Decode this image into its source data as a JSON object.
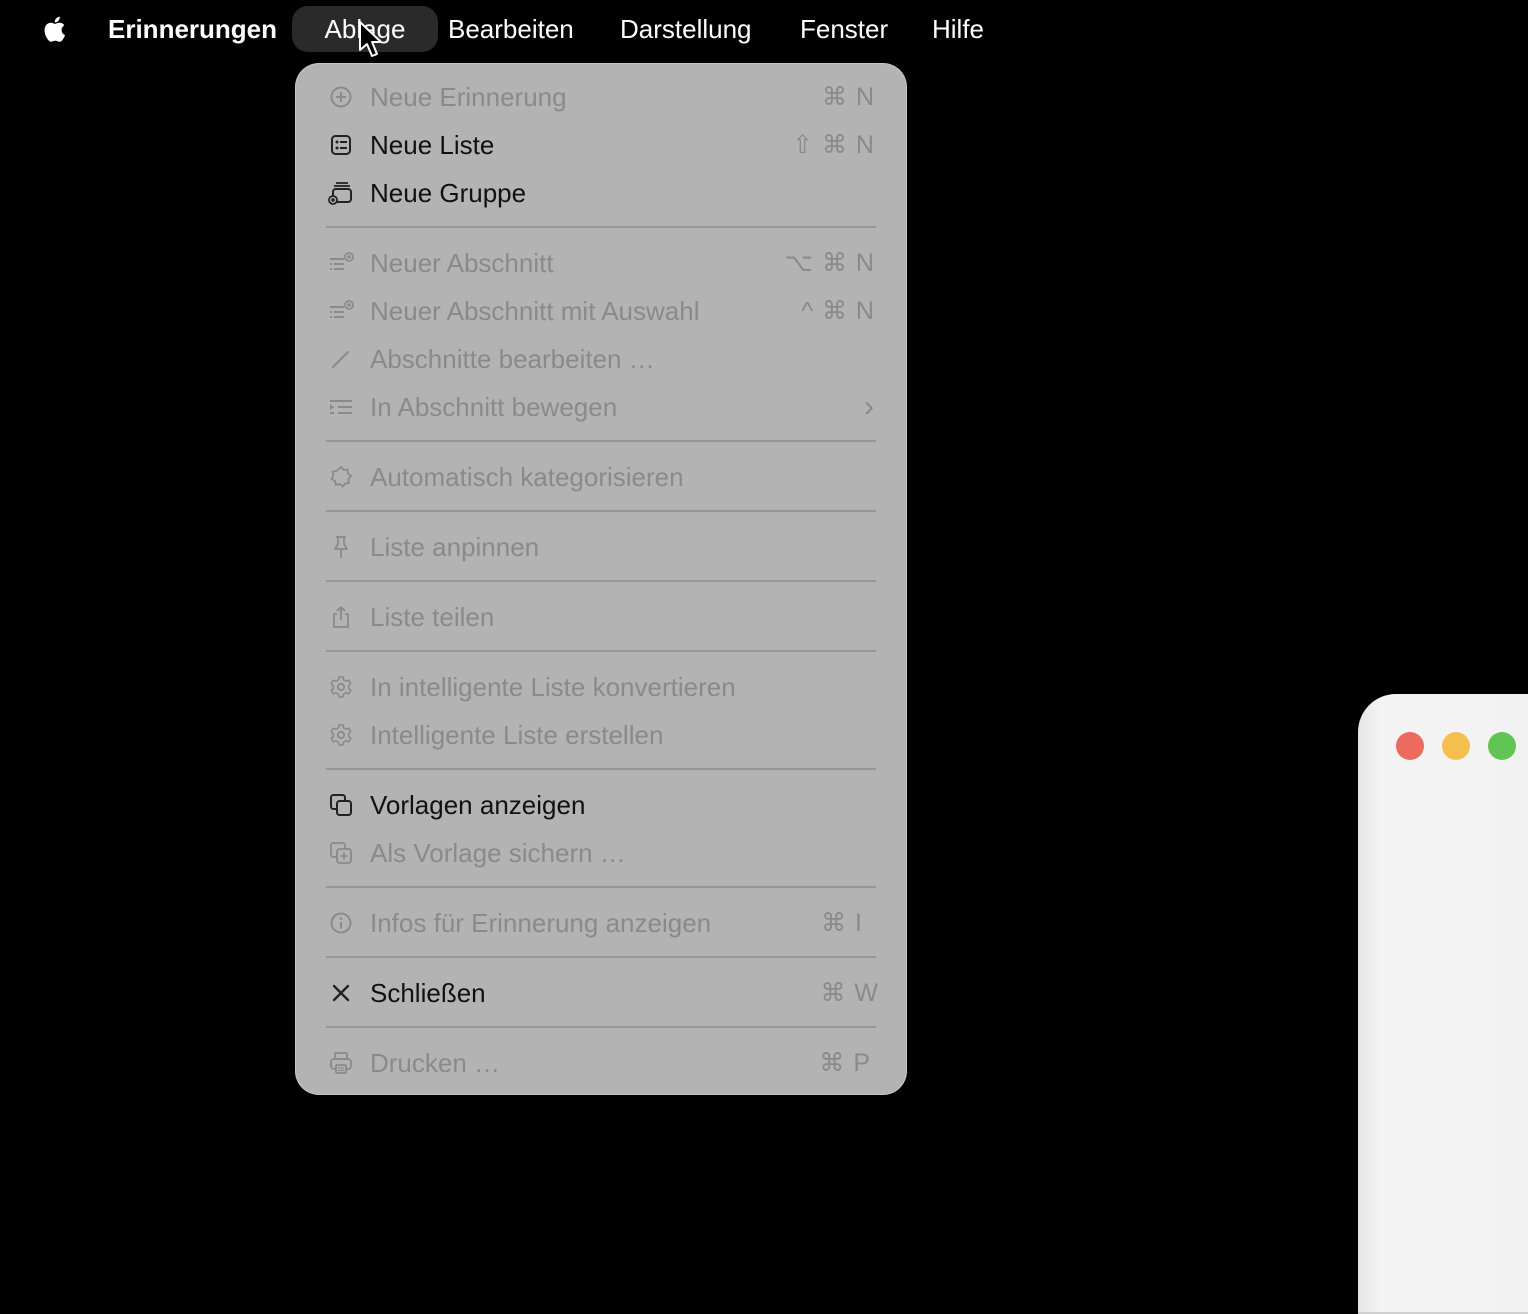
{
  "menubar": {
    "app_name": "Erinnerungen",
    "items": [
      "Ablage",
      "Bearbeiten",
      "Darstellung",
      "Fenster",
      "Hilfe"
    ]
  },
  "menu": {
    "items": [
      {
        "label": "Neue Erinnerung",
        "shortcut": "⌘ N",
        "icon": "plus-circle-icon",
        "enabled": false
      },
      {
        "label": "Neue Liste",
        "shortcut": "⇧ ⌘ N",
        "icon": "list-icon",
        "enabled": true
      },
      {
        "label": "Neue Gruppe",
        "shortcut": "",
        "icon": "group-stack-icon",
        "enabled": true
      },
      {
        "label": "Neuer Abschnitt",
        "shortcut": "⌥ ⌘ N",
        "icon": "section-add-icon",
        "enabled": false
      },
      {
        "label": "Neuer Abschnitt mit Auswahl",
        "shortcut": "^ ⌘ N",
        "icon": "section-add-icon",
        "enabled": false
      },
      {
        "label": "Abschnitte bearbeiten …",
        "shortcut": "",
        "icon": "pencil-icon",
        "enabled": false
      },
      {
        "label": "In Abschnitt bewegen",
        "shortcut": "›",
        "icon": "move-to-section-icon",
        "enabled": false
      },
      {
        "label": "Automatisch kategorisieren",
        "shortcut": "",
        "icon": "auto-categorize-icon",
        "enabled": false
      },
      {
        "label": "Liste anpinnen",
        "shortcut": "",
        "icon": "pin-icon",
        "enabled": false
      },
      {
        "label": "Liste teilen",
        "shortcut": "",
        "icon": "share-icon",
        "enabled": false
      },
      {
        "label": "In intelligente Liste konvertieren",
        "shortcut": "",
        "icon": "gear-icon",
        "enabled": false
      },
      {
        "label": "Intelligente Liste erstellen",
        "shortcut": "",
        "icon": "gear-icon",
        "enabled": false
      },
      {
        "label": "Vorlagen anzeigen",
        "shortcut": "",
        "icon": "templates-icon",
        "enabled": true
      },
      {
        "label": "Als Vorlage sichern …",
        "shortcut": "",
        "icon": "save-template-icon",
        "enabled": false
      },
      {
        "label": "Infos für Erinnerung anzeigen",
        "shortcut": "⌘ I",
        "icon": "info-icon",
        "enabled": false
      },
      {
        "label": "Schließen",
        "shortcut": "⌘ W",
        "icon": "close-icon",
        "enabled": true
      },
      {
        "label": "Drucken …",
        "shortcut": "⌘ P",
        "icon": "printer-icon",
        "enabled": false
      }
    ]
  },
  "colors": {
    "menu_bg": "#b3b3b3",
    "enabled_text": "#111111",
    "disabled_text": "#8a8a8a",
    "traffic_red": "#ec6a5e",
    "traffic_yellow": "#f4bf4f",
    "traffic_green": "#61c554"
  }
}
